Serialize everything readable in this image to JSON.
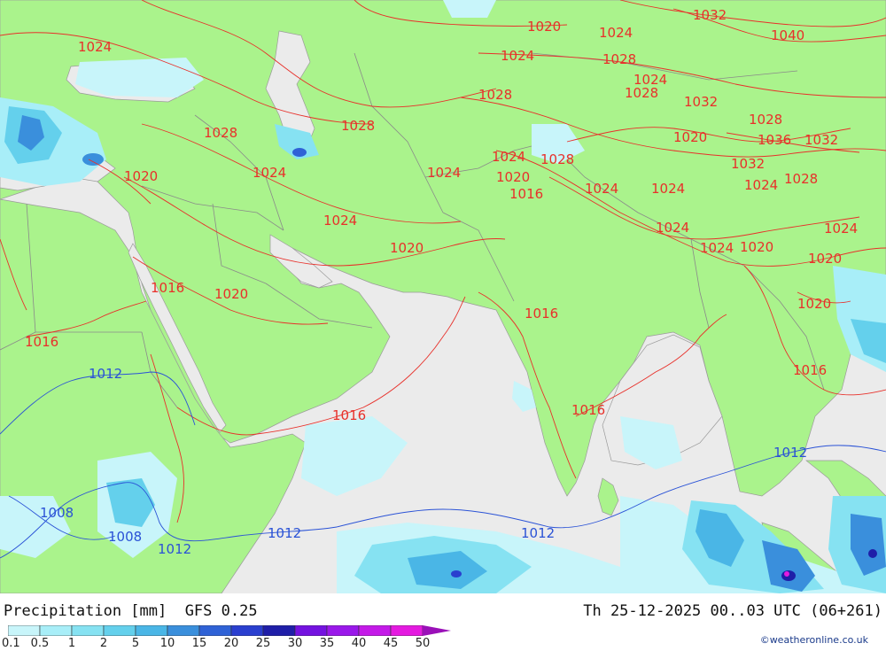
{
  "footer": {
    "title": "Precipitation [mm]  GFS 0.25",
    "valid_time": "Th 25-12-2025 00..03 UTC (06+261)",
    "credit": "©weatheronline.co.uk"
  },
  "legend": {
    "values": [
      "0.1",
      "0.5",
      "1",
      "2",
      "5",
      "10",
      "15",
      "20",
      "25",
      "30",
      "35",
      "40",
      "45",
      "50"
    ],
    "colors": [
      "#c8f5fa",
      "#a8eef8",
      "#86e2f2",
      "#64d0ec",
      "#4ab6e6",
      "#3a8fdc",
      "#2f62d6",
      "#2a3fcf",
      "#1f1ea8",
      "#7412e0",
      "#9a18ea",
      "#c41ae8",
      "#e41ae0",
      "#b010b8"
    ],
    "arrow_color": "#9a10b8"
  },
  "colors": {
    "land": "#aaf38c",
    "sea": "#ebebeb",
    "isobar_high": "#e8302a",
    "isobar_low": "#2a52d6",
    "border": "#8a8a8a"
  },
  "isobar_labels": [
    {
      "text": "1020",
      "color": "red"
    },
    {
      "text": "1024",
      "color": "red"
    },
    {
      "text": "1028",
      "color": "red"
    },
    {
      "text": "1032",
      "color": "red"
    },
    {
      "text": "1036",
      "color": "red"
    },
    {
      "text": "1040",
      "color": "red"
    },
    {
      "text": "1016",
      "color": "red"
    },
    {
      "text": "1012",
      "color": "blue"
    },
    {
      "text": "1008",
      "color": "blue"
    }
  ]
}
